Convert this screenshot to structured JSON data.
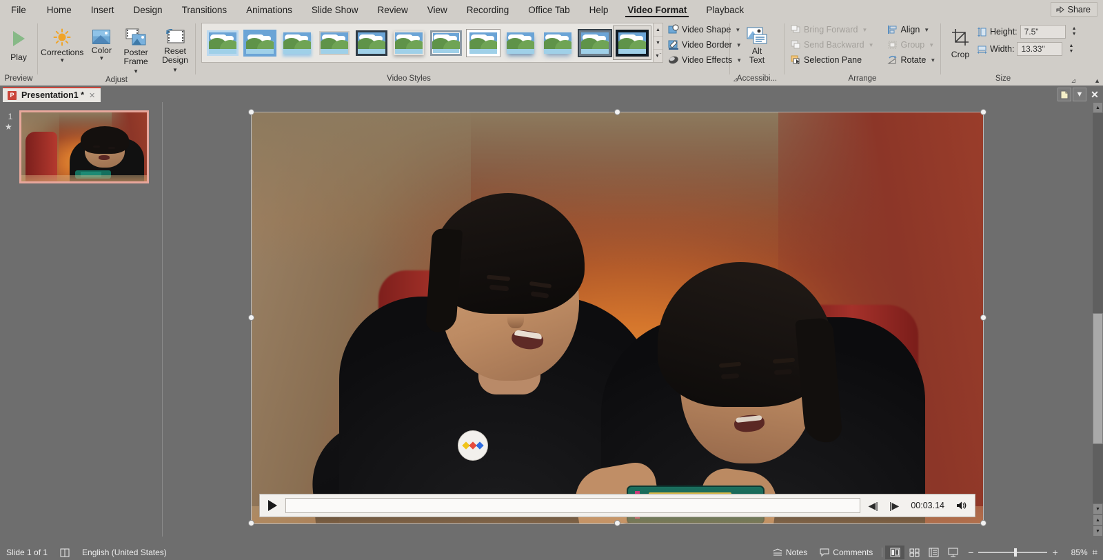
{
  "app": {
    "title": "Presentation1",
    "modified_marker": "*",
    "product_mark": "P"
  },
  "ribbon_tabs": [
    {
      "label": "File",
      "active": false
    },
    {
      "label": "Home",
      "active": false
    },
    {
      "label": "Insert",
      "active": false
    },
    {
      "label": "Design",
      "active": false
    },
    {
      "label": "Transitions",
      "active": false
    },
    {
      "label": "Animations",
      "active": false
    },
    {
      "label": "Slide Show",
      "active": false
    },
    {
      "label": "Review",
      "active": false
    },
    {
      "label": "View",
      "active": false
    },
    {
      "label": "Recording",
      "active": false
    },
    {
      "label": "Office Tab",
      "active": false
    },
    {
      "label": "Help",
      "active": false
    },
    {
      "label": "Video Format",
      "active": true
    },
    {
      "label": "Playback",
      "active": false
    }
  ],
  "share": {
    "label": "Share",
    "icon": "share-icon"
  },
  "ribbon": {
    "preview": {
      "group_label": "Preview",
      "play_label": "Play",
      "play_icon": "play-triangle-icon"
    },
    "adjust": {
      "group_label": "Adjust",
      "items": [
        {
          "label": "Corrections",
          "label2": "",
          "icon": "brightness-sun-icon",
          "has_caret": true
        },
        {
          "label": "Color",
          "label2": "",
          "icon": "color-picture-icon",
          "has_caret": true
        },
        {
          "label": "Poster",
          "label2": "Frame",
          "icon": "poster-frame-icon",
          "has_caret": true
        },
        {
          "label": "Reset",
          "label2": "Design",
          "icon": "reset-design-icon",
          "has_caret": true
        }
      ]
    },
    "video_styles": {
      "group_label": "Video Styles",
      "thumbnail_count": 12,
      "selected_index": 11,
      "scroll_up": "scroll-up-icon",
      "scroll_down": "scroll-down-icon",
      "more": "more-styles-icon"
    },
    "shape_border_effects": [
      {
        "label": "Video Shape",
        "icon": "video-shape-icon",
        "caret": true
      },
      {
        "label": "Video Border",
        "icon": "video-border-icon",
        "caret": true
      },
      {
        "label": "Video Effects",
        "icon": "video-effects-icon",
        "caret": true
      }
    ],
    "accessibility": {
      "group_label": "Accessibi...",
      "alt_text_line1": "Alt",
      "alt_text_line2": "Text",
      "icon": "alt-text-icon",
      "dialog_launcher": "dialog-launcher-icon"
    },
    "arrange": {
      "group_label": "Arrange",
      "items": [
        {
          "label": "Bring Forward",
          "icon": "bring-forward-icon",
          "disabled": true,
          "caret": true
        },
        {
          "label": "Send Backward",
          "icon": "send-backward-icon",
          "disabled": true,
          "caret": true
        },
        {
          "label": "Selection Pane",
          "icon": "selection-pane-icon",
          "disabled": false,
          "caret": false
        },
        {
          "label": "Align",
          "icon": "align-icon",
          "disabled": false,
          "caret": true
        },
        {
          "label": "Group",
          "icon": "group-icon",
          "disabled": true,
          "caret": true
        },
        {
          "label": "Rotate",
          "icon": "rotate-icon",
          "disabled": false,
          "caret": true
        }
      ]
    },
    "size": {
      "group_label": "Size",
      "crop_label": "Crop",
      "crop_icon": "crop-icon",
      "height_label": "Height:",
      "height_value": "7.5\"",
      "height_icon": "height-icon",
      "width_label": "Width:",
      "width_value": "13.33\"",
      "width_icon": "width-icon",
      "dialog_launcher": "dialog-launcher-icon"
    }
  },
  "doc_tabbar": {
    "tab_label": "Presentation1 *",
    "close_icon": "close-icon",
    "new_tab_icon": "new-document-icon",
    "dropdown_icon": "chevron-down-icon",
    "close_all_icon": "close-icon"
  },
  "thumbnail_pane": {
    "slide_number": "1",
    "animation_marker": "★",
    "selected": true
  },
  "video_player": {
    "play_icon": "play-icon",
    "prev_frame_icon": "previous-frame-icon",
    "next_frame_icon": "next-frame-icon",
    "timestamp": "00:03.14",
    "volume_icon": "volume-icon",
    "progress_percent": 0
  },
  "status_bar": {
    "slide_count": "Slide 1 of 1",
    "accessibility_icon": "accessibility-checker-icon",
    "language": "English (United States)",
    "notes_label": "Notes",
    "notes_icon": "notes-icon",
    "comments_label": "Comments",
    "comments_icon": "comments-icon",
    "views": [
      {
        "name": "normal-view",
        "icon": "normal-view-icon",
        "active": true
      },
      {
        "name": "slide-sorter-view",
        "icon": "slide-sorter-icon",
        "active": false
      },
      {
        "name": "reading-view",
        "icon": "reading-view-icon",
        "active": false
      },
      {
        "name": "slide-show-view",
        "icon": "slideshow-icon",
        "active": false
      }
    ],
    "zoom_out_icon": "minus-icon",
    "zoom_in_icon": "plus-icon",
    "zoom_value": "85%",
    "fit_slide_icon": "fit-to-window-icon"
  },
  "colors": {
    "ribbon_bg": "#d0cdc8",
    "workspace_bg": "#6e6e6e",
    "accent_red": "#c9453a",
    "selection_pink": "#e8a79c",
    "text": "#1d1d1d",
    "disabled_text": "#a3a09b"
  }
}
